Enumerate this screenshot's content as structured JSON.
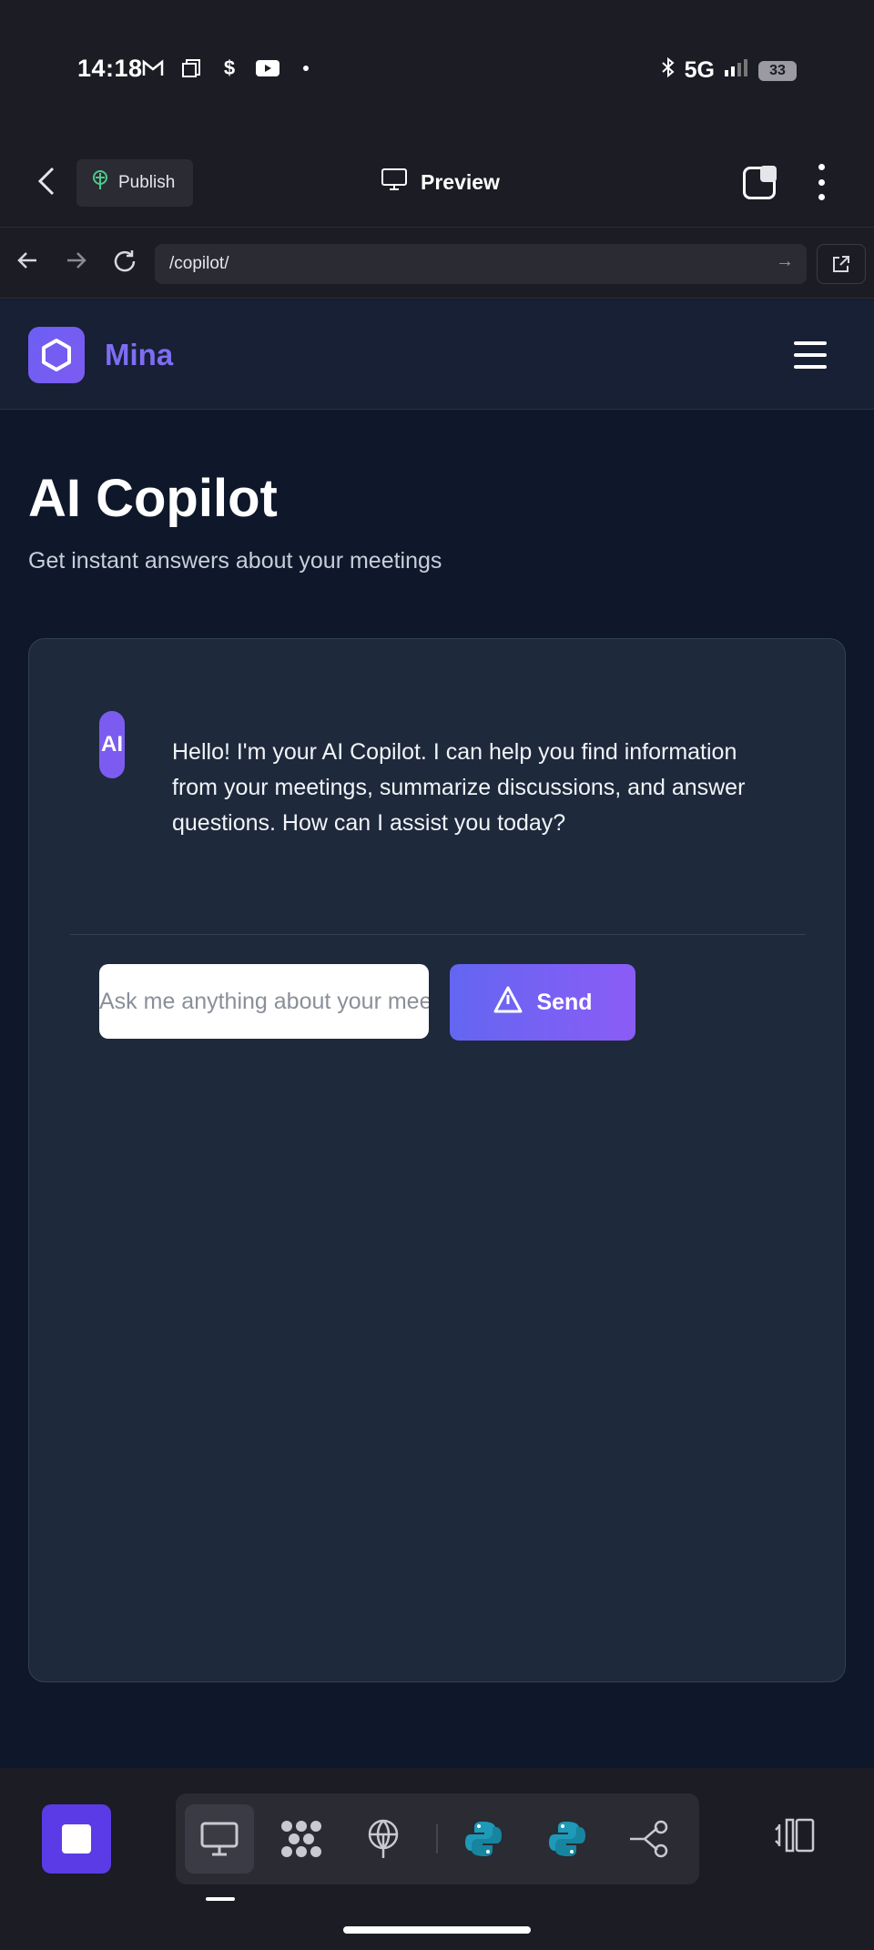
{
  "status_bar": {
    "time": "14:18",
    "left_icons": [
      "gmail-icon",
      "copy-icon",
      "dollar-icon",
      "youtube-icon",
      "dot-icon"
    ],
    "network": "5G",
    "battery": "33"
  },
  "app_toolbar": {
    "publish_label": "Publish",
    "preview_label": "Preview"
  },
  "url_bar": {
    "url": "/copilot/"
  },
  "site_header": {
    "brand": "Mina"
  },
  "page": {
    "title": "AI Copilot",
    "subtitle": "Get instant answers about your meetings"
  },
  "chat": {
    "ai_avatar_label": "AI",
    "ai_message": "Hello! I'm your AI Copilot. I can help you find information from your meetings, summarize discussions, and answer questions. How can I assist you today?",
    "input_placeholder": "Ask me anything about your meetings...",
    "input_value": "",
    "send_label": "Send"
  },
  "dock": {
    "tools": [
      "desktop-icon",
      "dots-grid-icon",
      "globe-publish-icon",
      "python-icon",
      "python-icon",
      "connector-icon"
    ],
    "colors": {
      "stop": "#5b3be6",
      "python": "#1e9ab8"
    }
  },
  "colors": {
    "brand": "#7f6df4",
    "accent_gradient_start": "#6366f1",
    "accent_gradient_end": "#8b5cf6",
    "page_bg": "#0f172a",
    "card_bg": "#1e293b"
  }
}
